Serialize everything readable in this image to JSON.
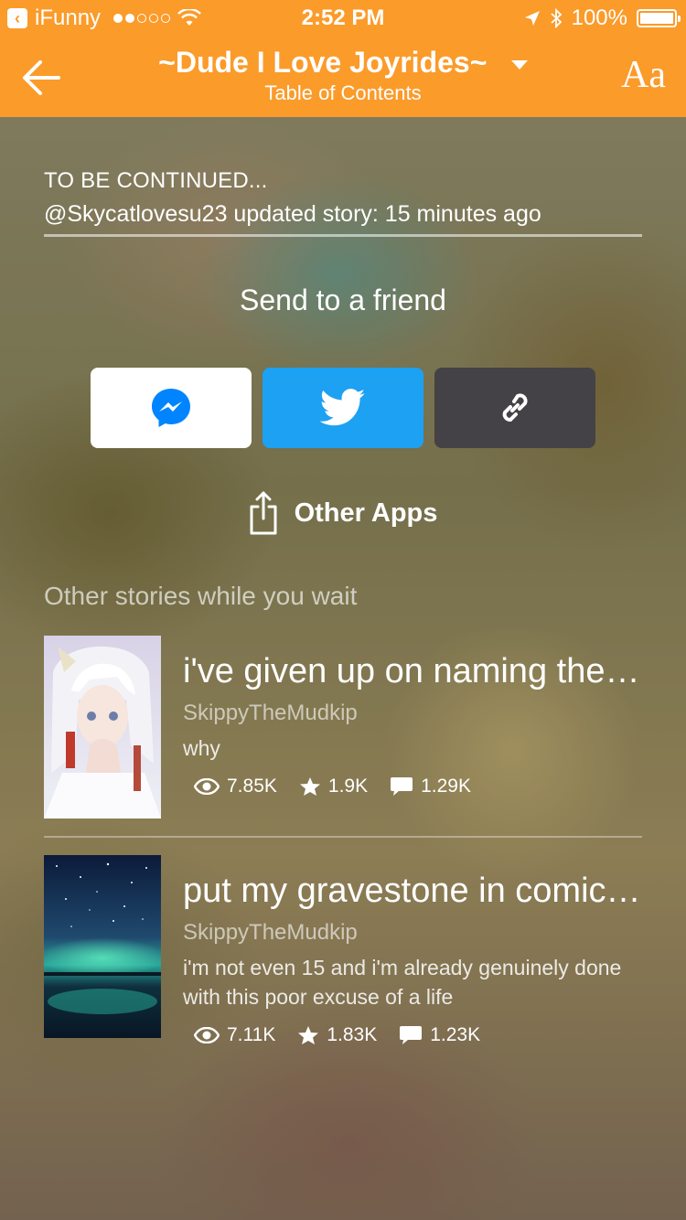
{
  "status_bar": {
    "back_app": "iFunny",
    "time": "2:52 PM",
    "battery": "100%",
    "battery_level": 1.0
  },
  "nav": {
    "title": "~Dude I Love Joyrides~",
    "subtitle": "Table of Contents",
    "font_button": "Aa"
  },
  "story_status": {
    "label": "TO BE CONTINUED...",
    "updated": "@Skycatlovesu23 updated story: 15 minutes ago"
  },
  "share": {
    "title": "Send to a friend",
    "other_apps": "Other Apps",
    "colors": {
      "messenger": "#0084ff",
      "twitter": "#1da1f2",
      "link": "#444246"
    }
  },
  "recommendations": {
    "header": "Other stories while you wait",
    "items": [
      {
        "title": "i've given up on naming the…",
        "author": "SkippyTheMudkip",
        "description": "why",
        "reads": "7.85K",
        "votes": "1.9K",
        "comments": "1.29K"
      },
      {
        "title": "put my gravestone in comic…",
        "author": "SkippyTheMudkip",
        "description": "i'm not even 15 and i'm already genuinely done with this poor excuse of a life",
        "reads": "7.11K",
        "votes": "1.83K",
        "comments": "1.23K"
      }
    ]
  },
  "accent_color": "#fb9b2a"
}
